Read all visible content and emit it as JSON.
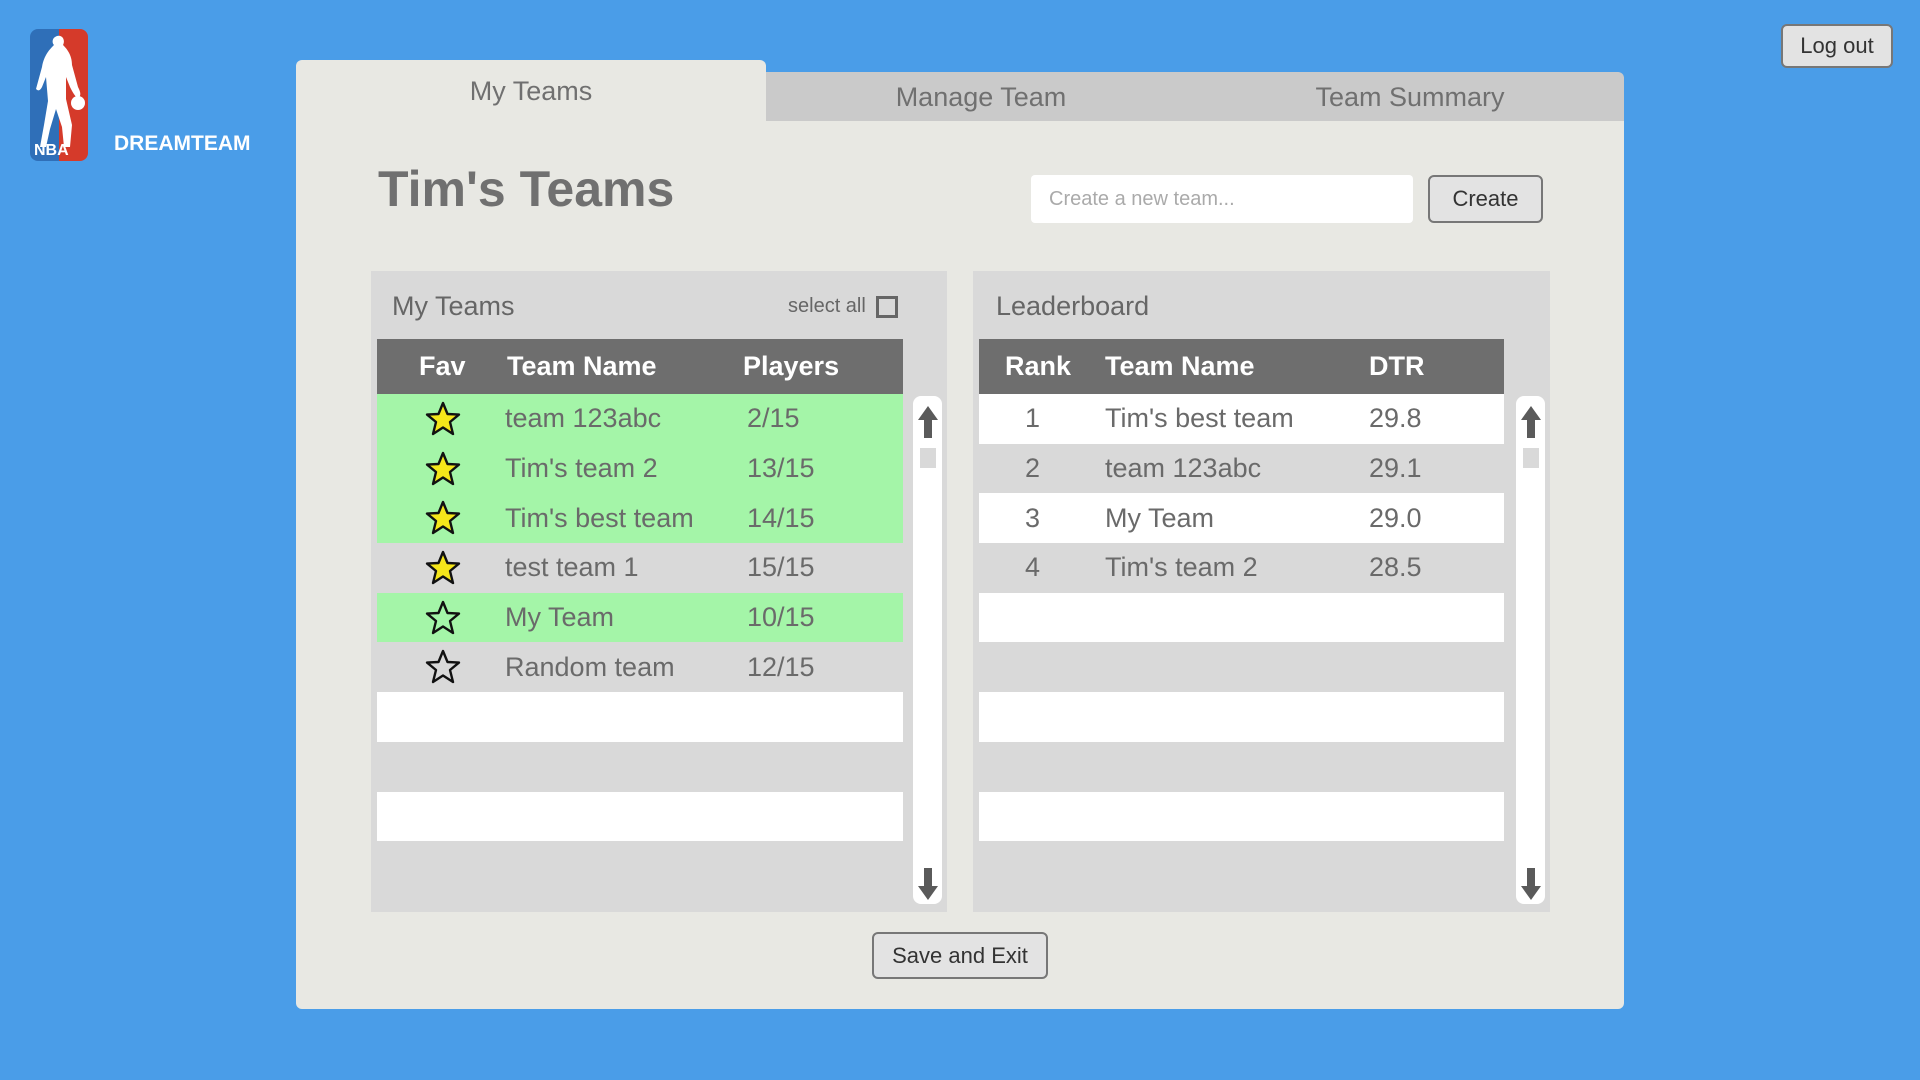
{
  "logo": {
    "text": "DREAMTEAM",
    "badge": "NBA"
  },
  "header": {
    "logout_label": "Log out"
  },
  "tabs": [
    {
      "label": "My Teams",
      "active": true
    },
    {
      "label": "Manage Team",
      "active": false
    },
    {
      "label": "Team Summary",
      "active": false
    }
  ],
  "page": {
    "title": "Tim's Teams",
    "new_team_placeholder": "Create a new team...",
    "new_team_value": "",
    "create_label": "Create",
    "save_label": "Save and Exit"
  },
  "my_teams": {
    "title": "My Teams",
    "select_all_label": "select all",
    "select_all_checked": false,
    "columns": [
      "Fav",
      "Team Name",
      "Players"
    ],
    "rows": [
      {
        "fav": true,
        "name": "team 123abc",
        "players": "2/15",
        "highlight": true
      },
      {
        "fav": true,
        "name": "Tim's team 2",
        "players": "13/15",
        "highlight": true
      },
      {
        "fav": true,
        "name": "Tim's best team",
        "players": "14/15",
        "highlight": true
      },
      {
        "fav": true,
        "name": "test team 1",
        "players": "15/15",
        "highlight": false
      },
      {
        "fav": false,
        "name": "My Team",
        "players": "10/15",
        "highlight": true
      },
      {
        "fav": false,
        "name": "Random team",
        "players": "12/15",
        "highlight": false
      }
    ]
  },
  "leaderboard": {
    "title": "Leaderboard",
    "columns": [
      "Rank",
      "Team Name",
      "DTR"
    ],
    "rows": [
      {
        "rank": "1",
        "name": "Tim's best team",
        "dtr": "29.8"
      },
      {
        "rank": "2",
        "name": "team 123abc",
        "dtr": "29.1"
      },
      {
        "rank": "3",
        "name": "My Team",
        "dtr": "29.0"
      },
      {
        "rank": "4",
        "name": "Tim's team 2",
        "dtr": "28.5"
      }
    ]
  },
  "icons": {
    "star_filled_color": "#f5e61a",
    "star_outline": "star-outline-icon",
    "scroll_up": "arrow-up-icon",
    "scroll_down": "arrow-down-icon"
  },
  "colors": {
    "background": "#4a9de8",
    "panel": "#e8e8e3",
    "header_row": "#6e6e6e",
    "highlight_row": "#a4f5a8"
  }
}
